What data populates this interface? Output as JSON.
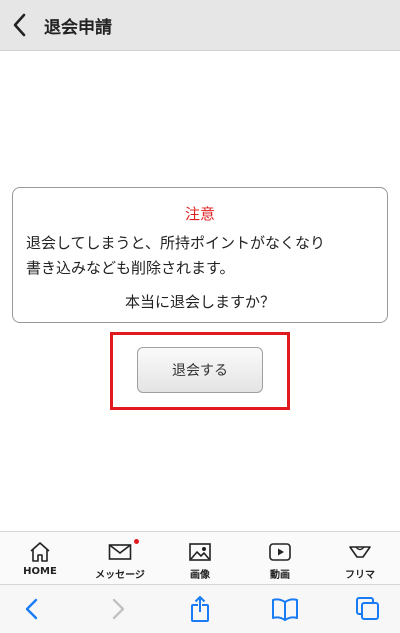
{
  "header": {
    "title": "退会申請"
  },
  "notice": {
    "title": "注意",
    "line1": "退会してしまうと、所持ポイントがなくなり",
    "line2": "書き込みなども削除されます。",
    "question": "本当に退会しますか？"
  },
  "withdraw_button": {
    "label": "退会する"
  },
  "tabbar": {
    "items": [
      {
        "label": "HOME",
        "icon": "home-icon"
      },
      {
        "label": "メッセージ",
        "icon": "mail-icon",
        "has_badge": true
      },
      {
        "label": "画像",
        "icon": "image-icon"
      },
      {
        "label": "動画",
        "icon": "video-icon"
      },
      {
        "label": "フリマ",
        "icon": "flea-market-icon"
      }
    ]
  },
  "browser_toolbar": {
    "items": [
      "back-arrow-icon",
      "forward-arrow-icon",
      "share-icon",
      "bookmarks-icon",
      "tabs-icon"
    ]
  },
  "colors": {
    "accent_blue": "#1a7cf5",
    "warning_red": "#e02020",
    "highlight_red": "#e0191f",
    "header_bg": "#e6e6e6"
  }
}
